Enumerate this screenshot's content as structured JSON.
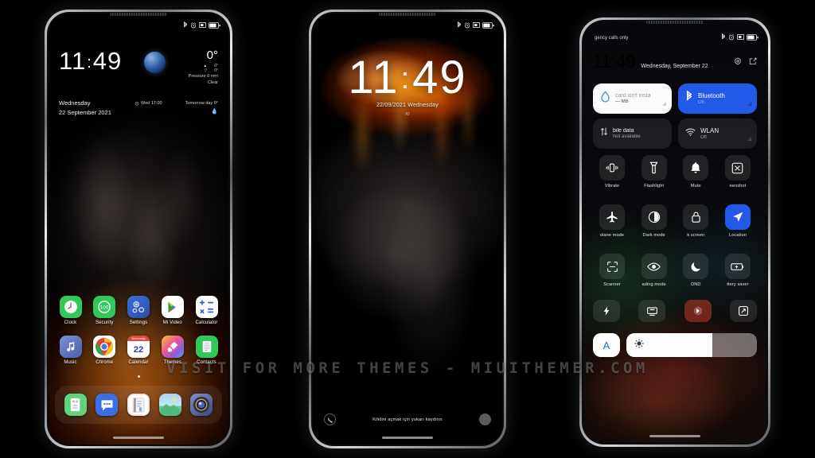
{
  "scene": {
    "watermark": "VISIT FOR MORE THEMES - MIUITHEMER.COM",
    "background_color": "#000000",
    "accent_blue": "#2159e8",
    "frame_color": "#c9ccd1"
  },
  "phone1": {
    "name": "home-screen",
    "statusbar": {
      "icons": [
        "bluetooth-icon",
        "alarm-icon",
        "sd-card-icon",
        "battery-icon"
      ]
    },
    "widget": {
      "time": "11",
      "colon": ":",
      "minutes": "49",
      "temperature": "0°",
      "high": "0°",
      "low": "0°",
      "pressure": "Pressure 0 mm",
      "condition": "Clear",
      "weekday": "Wednesday",
      "date": "22 September 2021",
      "alarm": "Wed 17:00",
      "tomorrow": "Tomorrow day 0°",
      "humidity_icon": "water-drop-icon"
    },
    "apps_row1": [
      {
        "label": "Clock",
        "icon": "clock-icon"
      },
      {
        "label": "Security",
        "icon": "security-icon"
      },
      {
        "label": "Settings",
        "icon": "settings-gear-icon"
      },
      {
        "label": "Mi Video",
        "icon": "play-triangle-icon"
      },
      {
        "label": "Calculator",
        "icon": "calculator-icon"
      }
    ],
    "apps_row2": [
      {
        "label": "Music",
        "icon": "music-note-icon"
      },
      {
        "label": "Chrome",
        "icon": "chrome-icon"
      },
      {
        "label": "Calendar",
        "icon": "calendar-icon",
        "day": "22",
        "month": "Wednesday"
      },
      {
        "label": "Themes",
        "icon": "themes-brush-icon"
      },
      {
        "label": "Contacts",
        "icon": "contacts-list-icon"
      }
    ],
    "dock": [
      {
        "label": "Tools",
        "icon": "toolbox-icon"
      },
      {
        "label": "Messages",
        "icon": "message-bubble-icon"
      },
      {
        "label": "Notes",
        "icon": "notes-icon"
      },
      {
        "label": "Gallery",
        "icon": "gallery-photo-icon"
      },
      {
        "label": "Camera",
        "icon": "camera-lens-icon"
      }
    ]
  },
  "phone2": {
    "name": "lock-screen",
    "statusbar": {
      "icons": [
        "bluetooth-icon",
        "alarm-icon",
        "sd-card-icon",
        "battery-icon"
      ]
    },
    "time_hours": "11",
    "time_colon": ":",
    "time_minutes": "49",
    "date_line": "22/09/2021 Wednesday",
    "sub_line": "/0",
    "unlock_hint": "Kilidini açmak için yukarı kaydırın",
    "left_shortcut": "phone-icon",
    "right_shortcut": "camera-icon"
  },
  "phone3": {
    "name": "control-center",
    "carrier": "gency calls only",
    "statusbar": {
      "icons": [
        "bluetooth-icon",
        "alarm-icon",
        "sd-card-icon",
        "battery-icon"
      ]
    },
    "time": "11:49",
    "date": "Wednesday, September 22",
    "header_icons": [
      {
        "name": "settings-icon"
      },
      {
        "name": "edit-icon"
      }
    ],
    "big_cards": [
      {
        "title": "card isn't insta",
        "subtitle": "— MB",
        "state": "light",
        "icon": "water-drop-icon"
      },
      {
        "title": "Bluetooth",
        "subtitle": "On",
        "state": "on",
        "icon": "bluetooth-icon"
      }
    ],
    "mid_cards": [
      {
        "title": "bile data",
        "subtitle": "Not available",
        "state": "off",
        "icon": "data-transfer-icon"
      },
      {
        "title": "WLAN",
        "subtitle": "Off",
        "state": "off",
        "icon": "wifi-icon"
      }
    ],
    "tiles_row1": [
      {
        "label": "Vibrate",
        "icon": "vibrate-icon",
        "on": false
      },
      {
        "label": "Flashlight",
        "icon": "flashlight-icon",
        "on": false
      },
      {
        "label": "Mute",
        "icon": "bell-icon",
        "on": false
      },
      {
        "label": "eenshot",
        "icon": "screenshot-icon",
        "on": false
      }
    ],
    "tiles_row2": [
      {
        "label": "olane mode",
        "icon": "airplane-icon",
        "on": false
      },
      {
        "label": "Dark mode",
        "icon": "contrast-icon",
        "on": false
      },
      {
        "label": "k screen",
        "icon": "lock-icon",
        "on": false
      },
      {
        "label": "Location",
        "icon": "location-arrow-icon",
        "on": true
      }
    ],
    "tiles_row3": [
      {
        "label": "Scanner",
        "icon": "scan-frame-icon",
        "on": false
      },
      {
        "label": "ading mode",
        "icon": "eye-icon",
        "on": false
      },
      {
        "label": "DND",
        "icon": "moon-icon",
        "on": false
      },
      {
        "label": "ttery saver",
        "icon": "battery-plus-icon",
        "on": false
      }
    ],
    "shortcuts": [
      {
        "icon": "lightning-icon",
        "style": "dim"
      },
      {
        "icon": "cast-icon",
        "style": "dim"
      },
      {
        "icon": "nfc-icon",
        "style": "red"
      },
      {
        "icon": "rotate-icon",
        "style": "dim"
      }
    ],
    "brightness": {
      "auto_label": "A",
      "icon": "brightness-sun-icon",
      "level_percent": 66
    }
  }
}
